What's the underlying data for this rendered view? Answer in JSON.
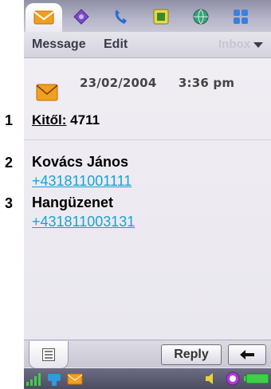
{
  "callouts": [
    "1",
    "2",
    "3"
  ],
  "tabs": [
    {
      "icon": "envelope-icon",
      "active": true
    },
    {
      "icon": "compose-icon"
    },
    {
      "icon": "phone-handset-icon"
    },
    {
      "icon": "contacts-icon"
    },
    {
      "icon": "globe-icon"
    },
    {
      "icon": "apps-grid-icon"
    }
  ],
  "menu": {
    "message_label": "Message",
    "edit_label": "Edit",
    "folder_label": "Inbox"
  },
  "message": {
    "date": "23/02/2004",
    "time": "3:36 pm",
    "from_label": "Kitől:",
    "from_value": "4711",
    "contacts": [
      {
        "name": "Kovács János",
        "phone": "+431811001111"
      },
      {
        "name": "Hangüzenet",
        "phone": "+431811003131"
      }
    ]
  },
  "actions": {
    "reply_label": "Reply",
    "back_icon": "back-arrow-icon"
  },
  "colors": {
    "link": "#1aa0d8",
    "tabbar": "#b6b5c9",
    "envelope": "#f0a020"
  }
}
